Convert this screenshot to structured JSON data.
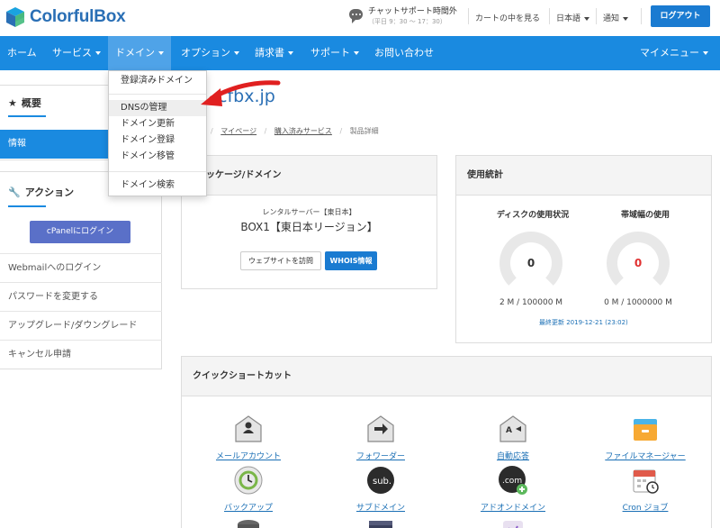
{
  "brand": {
    "name": "ColorfulBox"
  },
  "header": {
    "chat_title": "チャットサポート時間外",
    "chat_hours": "（平日 9：30 ～ 17：30）",
    "cart": "カートの中を見る",
    "language": "日本語",
    "notices": "通知",
    "logout": "ログアウト"
  },
  "nav": {
    "items": [
      "ホーム",
      "サービス",
      "ドメイン",
      "オプション",
      "請求書",
      "サポート",
      "お問い合わせ"
    ],
    "my_menu": "マイメニュー"
  },
  "dropdown": {
    "items": [
      "登録済みドメイン",
      "DNSの管理",
      "ドメイン更新",
      "ドメイン登録",
      "ドメイン移管",
      "ドメイン検索"
    ]
  },
  "sidebar": {
    "overview_title": "概要",
    "info_label": "情報",
    "actions_title": "アクション",
    "cpanel_button": "cPanelにログイン",
    "links": [
      "Webmailへのログイン",
      "パスワードを変更する",
      "アップグレード/ダウングレード",
      "キャンセル申請"
    ]
  },
  "main": {
    "title": ".cfbx.jp",
    "breadcrumb": [
      "マイページ",
      "購入済みサービス",
      "製品詳細"
    ],
    "package_card": {
      "title": "ッケージ/ドメイン",
      "plan_type": "レンタルサーバー【東日本】",
      "plan_name": "BOX1【東日本リージョン】",
      "visit_button": "ウェブサイトを訪問",
      "whois_button": "WHOIS情報"
    },
    "usage_card": {
      "title": "使用統計",
      "disk_label": "ディスクの使用状況",
      "bandwidth_label": "帯域幅の使用",
      "disk_value": "0",
      "bandwidth_value": "0",
      "disk_usage": "2 M / 100000 M",
      "bandwidth_usage": "0 M / 1000000 M",
      "updated": "最終更新 2019-12-21 (23:02)"
    },
    "shortcuts_card": {
      "title": "クイックショートカット",
      "items": [
        "メールアカウント",
        "フォワーダー",
        "自動応答",
        "ファイルマネージャー",
        "バックアップ",
        "サブドメイン",
        "アドオンドメイン",
        "Cron ジョブ"
      ]
    }
  },
  "colors": {
    "primary": "#1a8ae0",
    "brand_text": "#2a6fb5",
    "cpanel_button": "#5a70c8",
    "arrow": "#e02020",
    "bandwidth_value": "#e03030"
  }
}
